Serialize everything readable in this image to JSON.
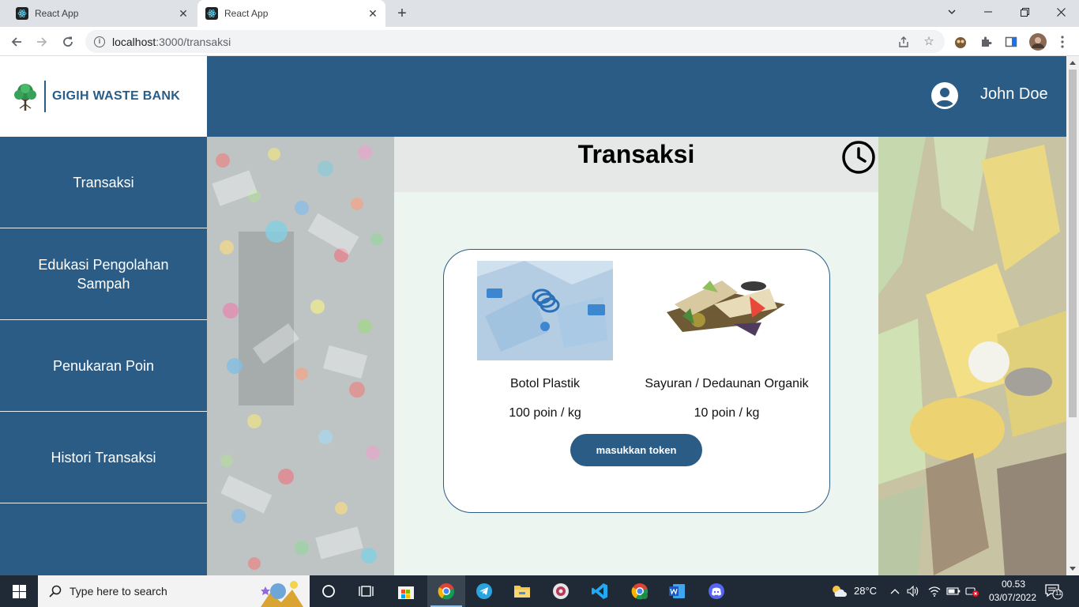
{
  "browser": {
    "tabs": [
      {
        "title": "React App",
        "active": false
      },
      {
        "title": "React App",
        "active": true
      }
    ],
    "url_host": "localhost",
    "url_rest": ":3000/transaksi"
  },
  "app": {
    "brand": "GIGIH WASTE BANK",
    "user_name": "John Doe",
    "sidebar": [
      {
        "label": "Transaksi"
      },
      {
        "label": "Edukasi Pengolahan Sampah"
      },
      {
        "label": "Penukaran Poin"
      },
      {
        "label": "Histori Transaksi"
      }
    ],
    "page_title": "Transaksi",
    "items": [
      {
        "name": "Botol Plastik",
        "price": "100 poin / kg"
      },
      {
        "name": "Sayuran / Dedaunan Organik",
        "price": "10 poin / kg"
      }
    ],
    "token_button": "masukkan token"
  },
  "taskbar": {
    "search_placeholder": "Type here to search",
    "weather": "28°C",
    "time": "00.53",
    "date": "03/07/2022",
    "notifications": "11"
  },
  "colors": {
    "primary": "#2b5c86",
    "content_bg": "#edf5f0"
  }
}
